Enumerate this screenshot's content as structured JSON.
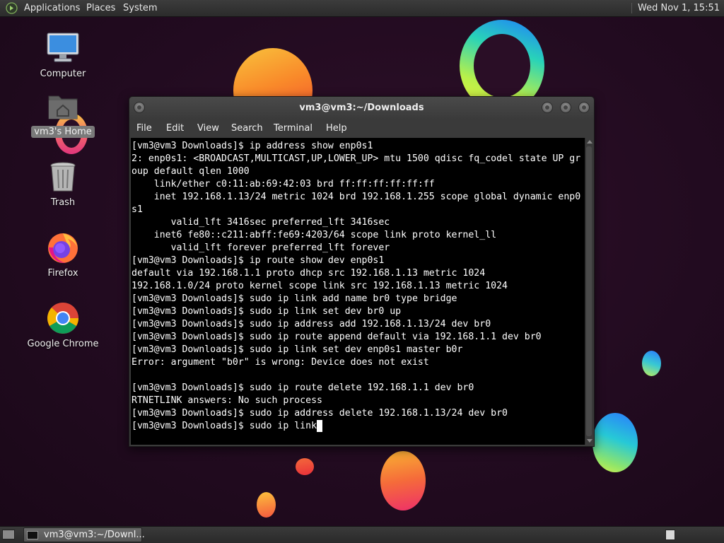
{
  "top_panel": {
    "menus": [
      "Applications",
      "Places",
      "System"
    ],
    "clock": "Wed Nov 1, 15:51"
  },
  "desktop_icons": [
    {
      "label": "Computer",
      "icon": "computer-icon"
    },
    {
      "label": "vm3's Home",
      "icon": "home-folder-icon"
    },
    {
      "label": "Trash",
      "icon": "trash-icon"
    },
    {
      "label": "Firefox",
      "icon": "firefox-icon"
    },
    {
      "label": "Google Chrome",
      "icon": "chrome-icon"
    }
  ],
  "terminal": {
    "title": "vm3@vm3:~/Downloads",
    "menus": [
      "File",
      "Edit",
      "View",
      "Search",
      "Terminal",
      "Help"
    ],
    "lines": [
      "[vm3@vm3 Downloads]$ ip address show enp0s1",
      "2: enp0s1: <BROADCAST,MULTICAST,UP,LOWER_UP> mtu 1500 qdisc fq_codel state UP gr",
      "oup default qlen 1000",
      "    link/ether c0:11:ab:69:42:03 brd ff:ff:ff:ff:ff:ff",
      "    inet 192.168.1.13/24 metric 1024 brd 192.168.1.255 scope global dynamic enp0",
      "s1",
      "       valid_lft 3416sec preferred_lft 3416sec",
      "    inet6 fe80::c211:abff:fe69:4203/64 scope link proto kernel_ll",
      "       valid_lft forever preferred_lft forever",
      "[vm3@vm3 Downloads]$ ip route show dev enp0s1",
      "default via 192.168.1.1 proto dhcp src 192.168.1.13 metric 1024",
      "192.168.1.0/24 proto kernel scope link src 192.168.1.13 metric 1024",
      "[vm3@vm3 Downloads]$ sudo ip link add name br0 type bridge",
      "[vm3@vm3 Downloads]$ sudo ip link set dev br0 up",
      "[vm3@vm3 Downloads]$ sudo ip address add 192.168.1.13/24 dev br0",
      "[vm3@vm3 Downloads]$ sudo ip route append default via 192.168.1.1 dev br0",
      "[vm3@vm3 Downloads]$ sudo ip link set dev enp0s1 master b0r",
      "Error: argument \"b0r\" is wrong: Device does not exist",
      "",
      "[vm3@vm3 Downloads]$ sudo ip route delete 192.168.1.1 dev br0",
      "RTNETLINK answers: No such process",
      "[vm3@vm3 Downloads]$ sudo ip address delete 192.168.1.13/24 dev br0",
      "[vm3@vm3 Downloads]$ sudo ip link"
    ]
  },
  "bottom_panel": {
    "task_label": "vm3@vm3:~/Downl..."
  }
}
